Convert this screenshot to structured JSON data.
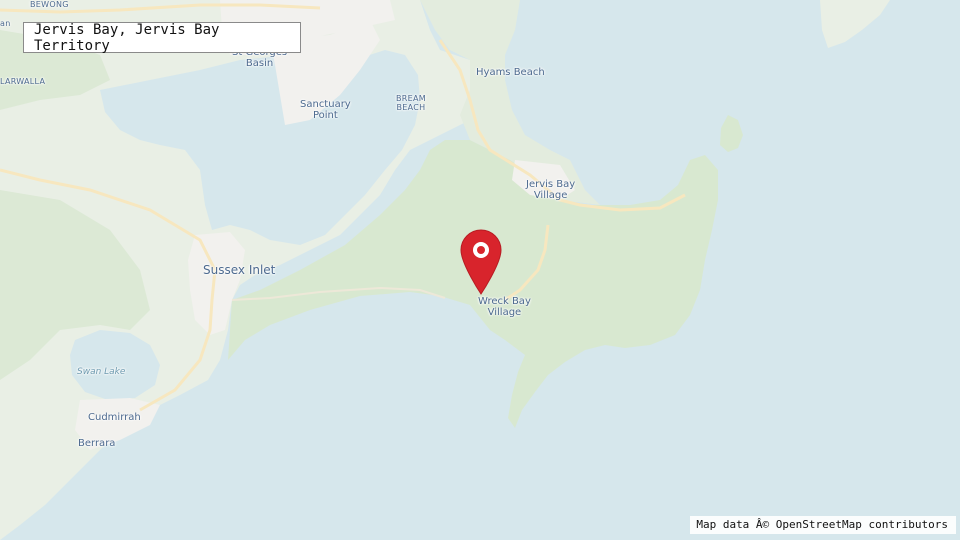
{
  "search": {
    "value": "Jervis Bay, Jervis Bay Territory"
  },
  "attribution": "Map data Â© OpenStreetMap contributors",
  "labels": {
    "bewong": "BEWONG",
    "st_georges_basin": "St Georges\nBasin",
    "sanctuary_point": "Sanctuary\nPoint",
    "bream_beach": "BREAM\nBEACH",
    "hyams_beach": "Hyams Beach",
    "larwalla": "LARWALLA",
    "jervis_bay_village": "Jervis Bay\nVillage",
    "sussex_inlet": "Sussex Inlet",
    "wreck_bay_village": "Wreck Bay\nVillage",
    "swan_lake": "Swan Lake",
    "cudmirrah": "Cudmirrah",
    "berrara": "Berrara",
    "an": "an"
  },
  "marker": {
    "icon": "map-pin-icon",
    "color": "#d8242c"
  },
  "colors": {
    "water": "#d6e7ec",
    "land": "#e9efe5",
    "forest": "#d8e8d0",
    "road": "#f7e7bf",
    "urban": "#f2f1ee",
    "label": "#4d6a8f"
  }
}
